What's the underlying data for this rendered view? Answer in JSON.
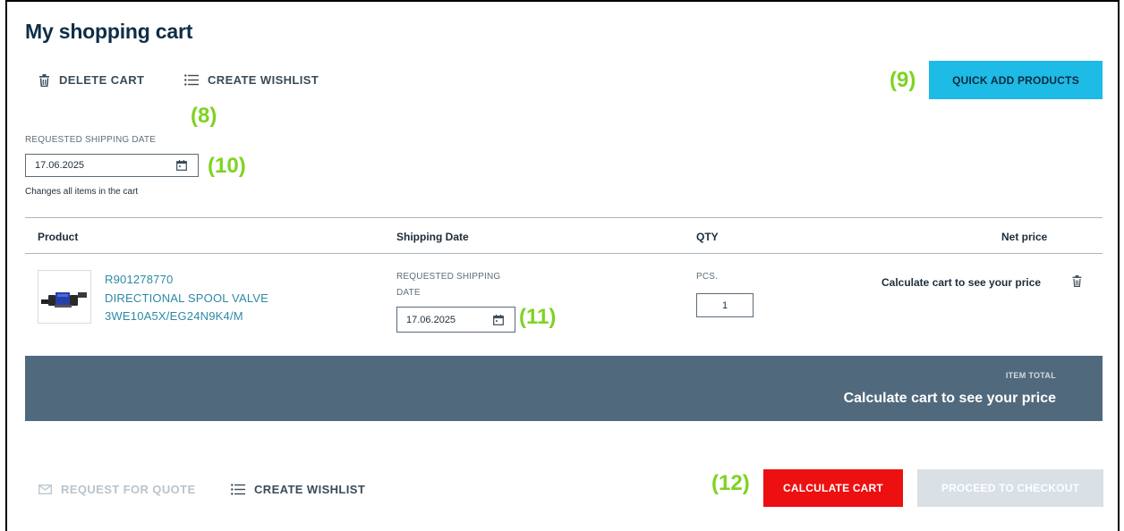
{
  "page": {
    "title": "My shopping cart"
  },
  "top_actions": {
    "delete_cart": "DELETE CART",
    "create_wishlist": "CREATE WISHLIST",
    "quick_add": "QUICK ADD PRODUCTS"
  },
  "markers": {
    "m8": "(8)",
    "m9": "(9)",
    "m10": "(10)",
    "m11": "(11)",
    "m12": "(12)"
  },
  "shipping": {
    "label": "REQUESTED SHIPPING DATE",
    "value": "17.06.2025",
    "hint": "Changes all items in the cart"
  },
  "table": {
    "headers": {
      "product": "Product",
      "shipping_date": "Shipping Date",
      "qty": "QTY",
      "net_price": "Net price"
    },
    "rows": [
      {
        "part_number": "R901278770",
        "name": "DIRECTIONAL SPOOL VALVE",
        "model": "3WE10A5X/EG24N9K4/M",
        "shipping_label_1": "REQUESTED SHIPPING",
        "shipping_label_2": "DATE",
        "shipping_date": "17.06.2025",
        "unit": "PCS.",
        "qty": "1",
        "price": "Calculate cart to see your price"
      }
    ]
  },
  "total": {
    "label": "ITEM TOTAL",
    "value": "Calculate cart to see your price"
  },
  "bottom_actions": {
    "request_quote": "REQUEST FOR QUOTE",
    "create_wishlist": "CREATE WISHLIST",
    "calculate": "CALCULATE CART",
    "checkout": "PROCEED TO CHECKOUT"
  },
  "icons": {
    "delete_cart": "trash-icon",
    "wishlist": "list-icon",
    "calendar": "calendar-icon",
    "remove_item": "trash-icon",
    "quote": "envelope-icon"
  },
  "colors": {
    "accent_cyan": "#1ebbe6",
    "calculate_red": "#ec1010",
    "total_bar": "#51697d",
    "link_teal": "#2d8aa6",
    "marker_green": "#7ed321",
    "disabled_button": "#d9e0e6"
  }
}
